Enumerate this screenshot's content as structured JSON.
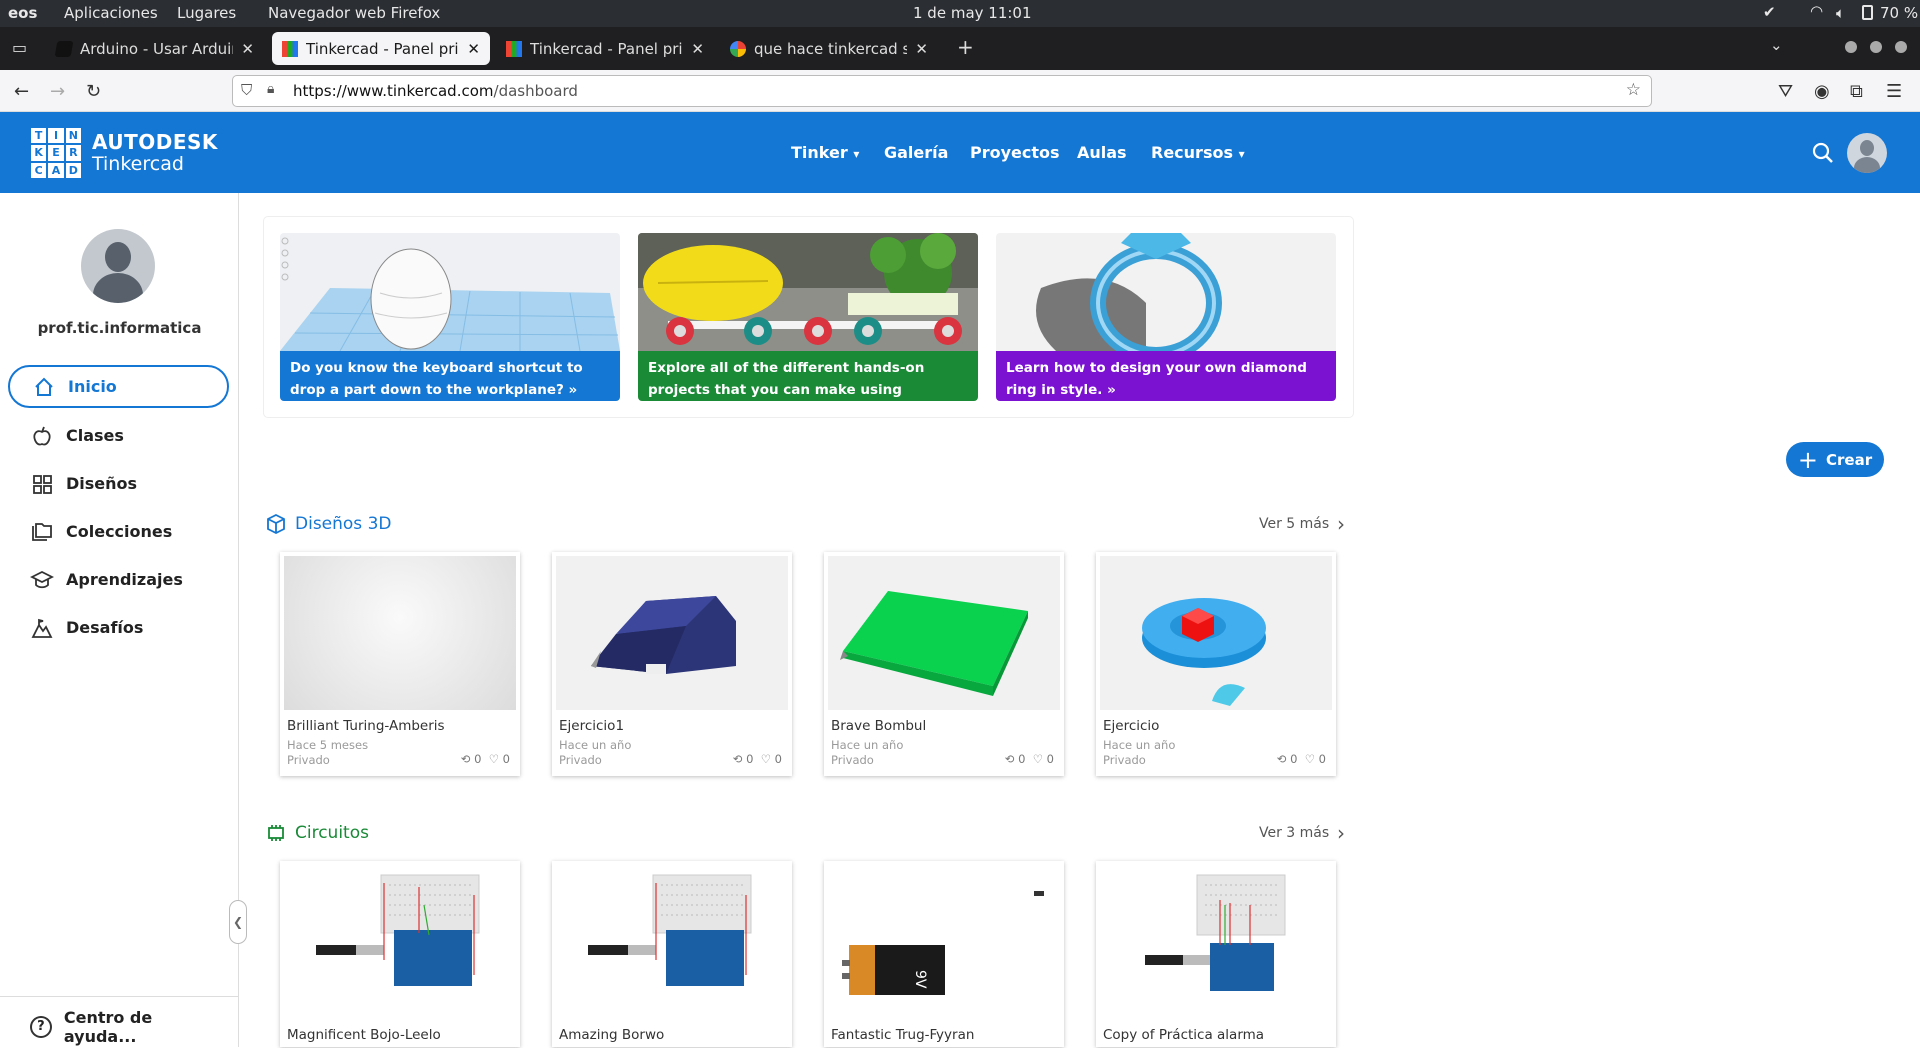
{
  "os": {
    "brand": "eos",
    "apps": "Aplicaciones",
    "places": "Lugares",
    "active_app": "Navegador web Firefox",
    "clock": "1 de may  11:01",
    "battery": "70 %"
  },
  "browser": {
    "tabs": [
      {
        "label": "Arduino - Usar Arduino d",
        "active": false,
        "favicon": "arduino-icon"
      },
      {
        "label": "Tinkercad - Panel principa",
        "active": true,
        "favicon": "tinkercad-icon"
      },
      {
        "label": "Tinkercad - Panel principa",
        "active": false,
        "favicon": "tinkercad-icon"
      },
      {
        "label": "que hace tinkercad simul",
        "active": false,
        "favicon": "google-icon"
      }
    ],
    "new_tab": "+",
    "url_host": "https://www.tinkercad.com",
    "url_path": "/dashboard"
  },
  "header": {
    "logo_letters": [
      "T",
      "I",
      "N",
      "K",
      "E",
      "R",
      "C",
      "A",
      "D"
    ],
    "brand_top": "AUTODESK",
    "brand_bottom": "Tinkercad",
    "nav": [
      {
        "label": "Tinker",
        "caret": "⌄"
      },
      {
        "label": "Galería"
      },
      {
        "label": "Proyectos"
      },
      {
        "label": "Aulas"
      },
      {
        "label": "Recursos",
        "caret": "⌄"
      }
    ]
  },
  "sidebar": {
    "username": "prof.tic.informatica",
    "items": [
      {
        "label": "Inicio",
        "active": true,
        "icon": "home-icon"
      },
      {
        "label": "Clases",
        "icon": "apple-icon"
      },
      {
        "label": "Diseños",
        "icon": "grid-icon"
      },
      {
        "label": "Colecciones",
        "icon": "folder-icon"
      },
      {
        "label": "Aprendizajes",
        "icon": "graduation-cap-icon"
      },
      {
        "label": "Desafíos",
        "icon": "mountain-icon"
      }
    ],
    "help": "Centro de ayuda...",
    "collapse": "❮"
  },
  "banners": [
    {
      "text": "Do you know the keyboard shortcut to drop a part down to the workplane? »",
      "color": "#1477d4"
    },
    {
      "text": "Explore all of the different hands-on projects that you can make using Tinkercad. »",
      "color": "#1a8a37"
    },
    {
      "text": "Learn how to design your own diamond ring in style. »",
      "color": "#7b12d1"
    }
  ],
  "create_button": "Crear",
  "designs": {
    "title": "Diseños 3D",
    "more": "Ver 5 más",
    "items": [
      {
        "name": "Brilliant Turing-Amberis",
        "time": "Hace 5 meses",
        "privacy": "Privado",
        "remixes": "0",
        "likes": "0"
      },
      {
        "name": "Ejercicio1",
        "time": "Hace un año",
        "privacy": "Privado",
        "remixes": "0",
        "likes": "0"
      },
      {
        "name": "Brave Bombul",
        "time": "Hace un año",
        "privacy": "Privado",
        "remixes": "0",
        "likes": "0"
      },
      {
        "name": "Ejercicio",
        "time": "Hace un año",
        "privacy": "Privado",
        "remixes": "0",
        "likes": "0"
      }
    ]
  },
  "circuits": {
    "title": "Circuitos",
    "more": "Ver 3 más",
    "items": [
      {
        "name": "Magnificent Bojo-Leelo"
      },
      {
        "name": "Amazing Borwo"
      },
      {
        "name": "Fantastic Trug-Fyyran",
        "battery_label": "9V"
      },
      {
        "name": "Copy of Práctica alarma"
      }
    ]
  }
}
